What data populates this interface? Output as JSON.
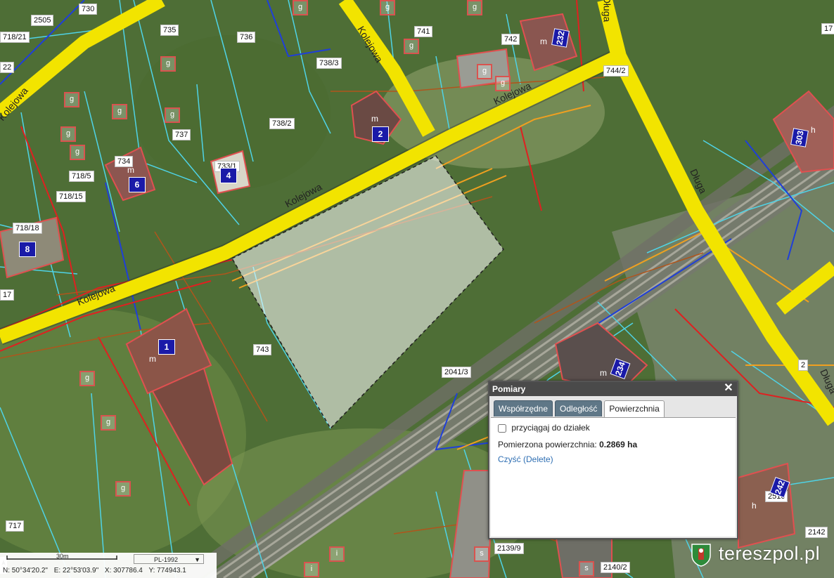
{
  "map": {
    "parcel_labels": [
      "730",
      "2505",
      "735",
      "736",
      "718/21",
      "741",
      "742",
      "232",
      "744/2",
      "738/3",
      "738/2",
      "737",
      "734",
      "733/1",
      "718/5",
      "718/15",
      "718/18",
      "743",
      "2041/3",
      "717",
      "2139/9",
      "2140/2",
      "2142",
      "2510",
      "17",
      "22",
      "17",
      "2"
    ],
    "street_labels": [
      "Kolejowa",
      "Kolejowa",
      "Kolejowa",
      "Kolejowa",
      "Kolejowa",
      "Długa",
      "Długa",
      "Długa"
    ],
    "building_numbers": [
      "232",
      "2",
      "6",
      "4",
      "8",
      "1",
      "303",
      "234",
      "242"
    ],
    "building_types": [
      "m",
      "m",
      "m",
      "m",
      "h",
      "h",
      "m"
    ],
    "small_buildings": [
      "g",
      "g",
      "g",
      "g",
      "g",
      "g",
      "g",
      "g",
      "g",
      "g",
      "g",
      "g",
      "g",
      "g",
      "g",
      "i",
      "i",
      "s",
      "s"
    ]
  },
  "panel": {
    "title": "Pomiary",
    "close_icon": "close-icon",
    "tabs": [
      "Współrzędne",
      "Odległość",
      "Powierzchnia"
    ],
    "active_tab": "Powierzchnia",
    "snap_label": "przyciągaj do działek",
    "snap_checked": false,
    "area_label": "Pomierzona powierzchnia:",
    "area_value": "0.2869 ha",
    "clear_link": "Czyść (Delete)"
  },
  "statusbar": {
    "scale_label": "30m",
    "projection": "PL-1992",
    "lat": "N: 50°34'20.2\"",
    "lon": "E: 22°53'03.9\"",
    "x": "X: 307786.4",
    "y": "Y: 774943.1"
  },
  "logo": {
    "text": "tereszpol.pl"
  },
  "colors": {
    "road": "#f2e400",
    "parcel": "#4fd3e6",
    "building": "#e05050",
    "measure_fill": "#ffffff"
  }
}
